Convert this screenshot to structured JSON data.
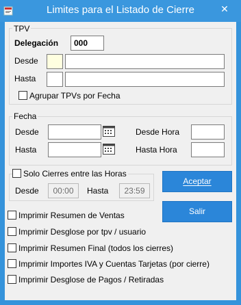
{
  "window": {
    "title": "Limites para el Listado de Cierre",
    "close_glyph": "✕"
  },
  "tpv": {
    "group_label": "TPV",
    "delegacion_label": "Delegación",
    "delegacion_value": "000",
    "desde_label": "Desde",
    "hasta_label": "Hasta",
    "desde_code": "",
    "desde_name": "",
    "hasta_code": "",
    "hasta_name": "",
    "agrupar_label": "Agrupar TPVs por Fecha"
  },
  "fecha": {
    "group_label": "Fecha",
    "desde_label": "Desde",
    "hasta_label": "Hasta",
    "desde_hora_label": "Desde Hora",
    "hasta_hora_label": "Hasta Hora",
    "desde_value": "",
    "hasta_value": "",
    "desde_hora_value": "",
    "hasta_hora_value": ""
  },
  "horas": {
    "solo_cierres_label": "Solo Cierres entre las Horas",
    "desde_label": "Desde",
    "hasta_label": "Hasta",
    "desde_value": "00:00",
    "hasta_value": "23:59"
  },
  "buttons": {
    "aceptar_label": "Aceptar",
    "salir_label": "Salir"
  },
  "options": [
    "Imprimir Resumen de Ventas",
    "Imprimir Desglose por tpv / usuario",
    "Imprimir Resumen Final (todos los cierres)",
    "Imprimir Importes IVA y Cuentas Tarjetas (por cierre)",
    "Imprimir Desglose de Pagos / Retiradas"
  ],
  "colors": {
    "titlebar": "#3a97de",
    "button": "#2b86d9",
    "field_highlight": "#ffffe0"
  },
  "icons": {
    "app": "app-icon",
    "close": "close-icon",
    "calendar": "calendar-icon"
  }
}
